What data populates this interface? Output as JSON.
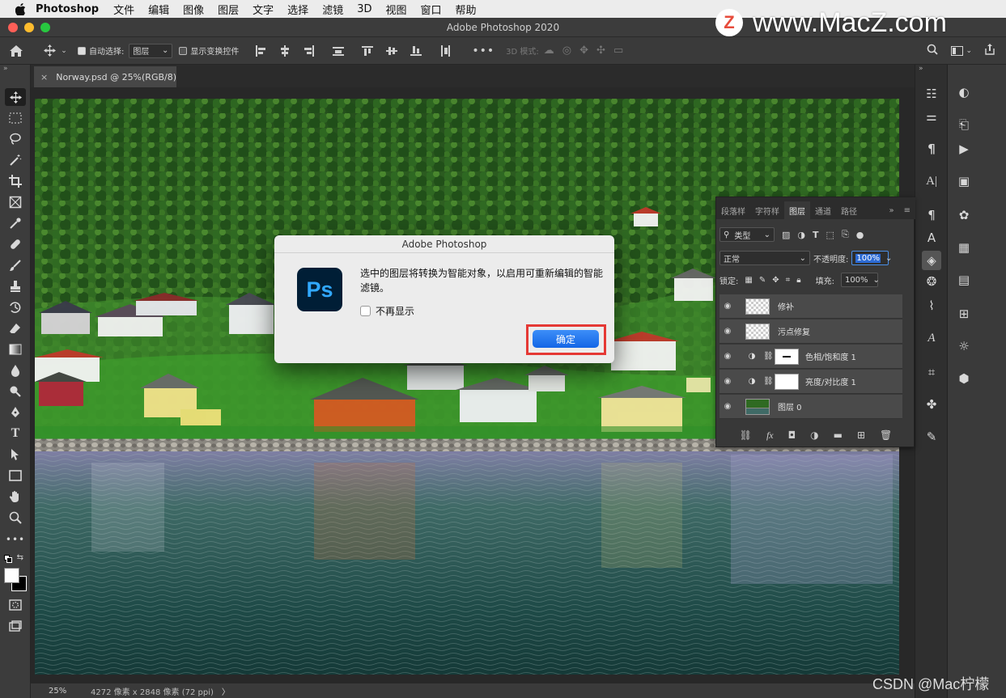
{
  "menubar": {
    "app_name": "Photoshop",
    "items": [
      "文件",
      "编辑",
      "图像",
      "图层",
      "文字",
      "选择",
      "滤镜",
      "3D",
      "视图",
      "窗口",
      "帮助"
    ]
  },
  "window": {
    "title": "Adobe Photoshop 2020"
  },
  "options_bar": {
    "auto_select_label": "自动选择:",
    "auto_select_value": "图层",
    "show_transform_label": "显示变换控件",
    "mode_3d_label": "3D 模式:"
  },
  "document_tab": {
    "title": "Norway.psd @ 25%(RGB/8)"
  },
  "status_bar": {
    "zoom": "25%",
    "info": "4272 像素 x 2848 像素 (72 ppi)"
  },
  "layers_panel": {
    "tabs": [
      "段落样",
      "字符样",
      "图层",
      "通道",
      "路径"
    ],
    "active_tab_index": 2,
    "filter_kind": "类型",
    "blend_mode": "正常",
    "opacity_label": "不透明度:",
    "opacity_value": "100%",
    "lock_label": "锁定:",
    "fill_label": "填充:",
    "fill_value": "100%",
    "layers": [
      {
        "name": "修补",
        "type": "pixel"
      },
      {
        "name": "污点修复",
        "type": "pixel"
      },
      {
        "name": "色相/饱和度 1",
        "type": "adjustment"
      },
      {
        "name": "亮度/对比度 1",
        "type": "adjustment"
      },
      {
        "name": "图层 0",
        "type": "image"
      }
    ]
  },
  "dialog": {
    "title": "Adobe Photoshop",
    "logo_text": "Ps",
    "message": "选中的图层将转换为智能对象，以启用可重新编辑的智能滤镜。",
    "checkbox_label": "不再显示",
    "ok_label": "确定"
  },
  "watermarks": {
    "top_logo": "Z",
    "top_text": "www.MacZ.com",
    "bottom_text": "CSDN @Mac柠檬"
  },
  "colors": {
    "accent": "#1473e6",
    "highlight_box": "#e53935",
    "ps_logo_bg": "#001e36",
    "ps_logo_fg": "#31a8ff"
  }
}
